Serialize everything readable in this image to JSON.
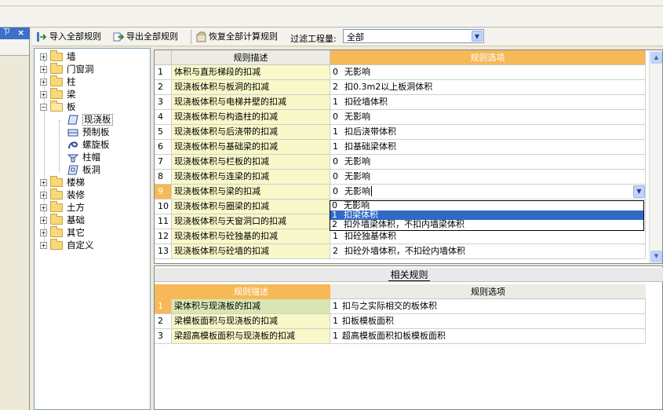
{
  "left_panel": {
    "pin": "ㄗ",
    "close": "×"
  },
  "toolbar": {
    "import_label": "导入全部规则",
    "export_label": "导出全部规则",
    "restore_label": "恢复全部计算规则",
    "filter_label": "过滤工程量:",
    "filter_value": "全部"
  },
  "tree": {
    "items": [
      {
        "label": "墙",
        "expander": "+"
      },
      {
        "label": "门窗洞",
        "expander": "+"
      },
      {
        "label": "柱",
        "expander": "+"
      },
      {
        "label": "梁",
        "expander": "+"
      },
      {
        "label": "板",
        "expander": "−"
      },
      {
        "label": "楼梯",
        "expander": "+"
      },
      {
        "label": "装修",
        "expander": "+"
      },
      {
        "label": "土方",
        "expander": "+"
      },
      {
        "label": "基础",
        "expander": "+"
      },
      {
        "label": "其它",
        "expander": "+"
      },
      {
        "label": "自定义",
        "expander": "+"
      }
    ],
    "children": [
      "现浇板",
      "预制板",
      "螺旋板",
      "柱帽",
      "板洞"
    ]
  },
  "grid": {
    "headers": [
      "规则描述",
      "规则选项"
    ],
    "rows": [
      {
        "num": "1",
        "desc": "体积与直形梯段的扣减",
        "code": "0",
        "opt": "无影响"
      },
      {
        "num": "2",
        "desc": "现浇板体积与板洞的扣减",
        "code": "2",
        "opt": "扣0.3m2以上板洞体积"
      },
      {
        "num": "3",
        "desc": "现浇板体积与电梯井壁的扣减",
        "code": "1",
        "opt": "扣砼墙体积"
      },
      {
        "num": "4",
        "desc": "现浇板体积与构造柱的扣减",
        "code": "0",
        "opt": "无影响"
      },
      {
        "num": "5",
        "desc": "现浇板体积与后浇带的扣减",
        "code": "1",
        "opt": "扣后浇带体积"
      },
      {
        "num": "6",
        "desc": "现浇板体积与基础梁的扣减",
        "code": "1",
        "opt": "扣基础梁体积"
      },
      {
        "num": "7",
        "desc": "现浇板体积与栏板的扣减",
        "code": "0",
        "opt": "无影响"
      },
      {
        "num": "8",
        "desc": "现浇板体积与连梁的扣减",
        "code": "0",
        "opt": "无影响"
      },
      {
        "num": "9",
        "desc": "现浇板体积与梁的扣减",
        "code": "0",
        "opt": "无影响"
      },
      {
        "num": "10",
        "desc": "现浇板体积与圈梁的扣减",
        "code": "",
        "opt": ""
      },
      {
        "num": "11",
        "desc": "现浇板体积与天窗洞口的扣减",
        "code": "",
        "opt": ""
      },
      {
        "num": "12",
        "desc": "现浇板体积与砼独基的扣减",
        "code": "1",
        "opt": "扣砼独基体积"
      },
      {
        "num": "13",
        "desc": "现浇板体积与砼墙的扣减",
        "code": "2",
        "opt": "扣砼外墙体积，不扣砼内墙体积"
      }
    ]
  },
  "dropdown": {
    "items": [
      {
        "code": "0",
        "label": "无影响"
      },
      {
        "code": "1",
        "label": "扣梁体积"
      },
      {
        "code": "2",
        "label": "扣外墙梁体积，不扣内墙梁体积"
      }
    ]
  },
  "related": {
    "title": "相关规则",
    "headers": [
      "规则描述",
      "规则选项"
    ],
    "rows": [
      {
        "num": "1",
        "desc": "梁体积与现浇板的扣减",
        "code": "1",
        "opt": "扣与之实际相交的板体积"
      },
      {
        "num": "2",
        "desc": "梁模板面积与现浇板的扣减",
        "code": "1",
        "opt": "扣板模板面积"
      },
      {
        "num": "3",
        "desc": "梁超高模板面积与现浇板的扣减",
        "code": "1",
        "opt": "超高模板面积扣板模板面积"
      }
    ]
  }
}
